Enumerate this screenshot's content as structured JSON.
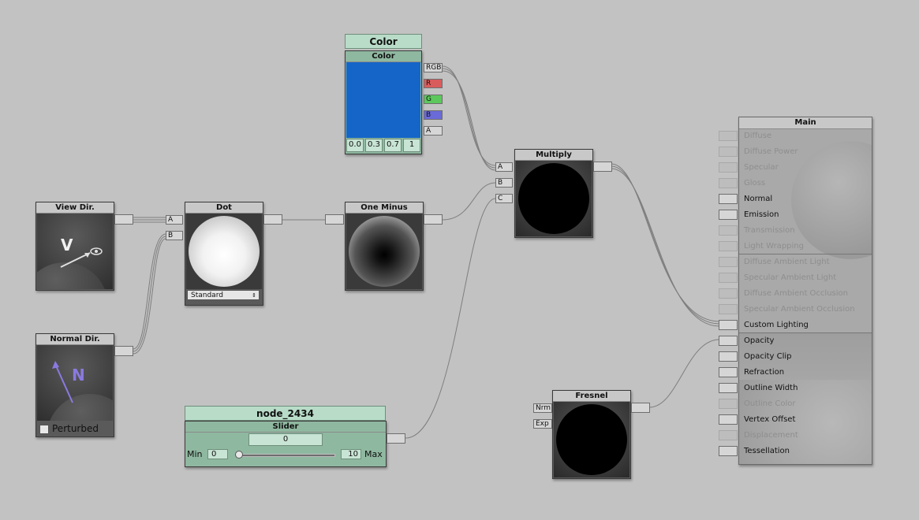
{
  "nodes": {
    "color": {
      "header": "Color",
      "title": "Color",
      "swatch": "#1565c8",
      "ports": [
        "RGB",
        "R",
        "G",
        "B",
        "A"
      ],
      "values": [
        "0.0",
        "0.3",
        "0.7",
        "1"
      ]
    },
    "view_dir": {
      "title": "View Dir.",
      "glyph": "V"
    },
    "normal_dir": {
      "title": "Normal Dir.",
      "glyph": "N",
      "checkbox_label": "Perturbed",
      "checkbox_checked": false
    },
    "dot": {
      "title": "Dot",
      "inputs": [
        "A",
        "B"
      ],
      "mode": "Standard"
    },
    "one_minus": {
      "title": "One Minus"
    },
    "multiply": {
      "title": "Multiply",
      "inputs": [
        "A",
        "B",
        "C"
      ]
    },
    "fresnel": {
      "title": "Fresnel",
      "inputs": [
        "Nrm",
        "Exp"
      ]
    },
    "slider": {
      "header": "node_2434",
      "title": "Slider",
      "value": "0",
      "min_label": "Min",
      "min_value": "0",
      "max_value": "10",
      "max_label": "Max",
      "level": 0.0
    }
  },
  "main": {
    "title": "Main",
    "rows": [
      {
        "label": "Diffuse",
        "active": false
      },
      {
        "label": "Diffuse Power",
        "active": false
      },
      {
        "label": "Specular",
        "active": false
      },
      {
        "label": "Gloss",
        "active": false
      },
      {
        "label": "Normal",
        "active": true
      },
      {
        "label": "Emission",
        "active": true
      },
      {
        "label": "Transmission",
        "active": false
      },
      {
        "label": "Light Wrapping",
        "active": false
      },
      {
        "label": "Diffuse Ambient Light",
        "active": false
      },
      {
        "label": "Specular Ambient Light",
        "active": false
      },
      {
        "label": "Diffuse Ambient Occlusion",
        "active": false
      },
      {
        "label": "Specular Ambient Occlusion",
        "active": false
      },
      {
        "label": "Custom Lighting",
        "active": true
      },
      {
        "label": "Opacity",
        "active": true
      },
      {
        "label": "Opacity Clip",
        "active": true
      },
      {
        "label": "Refraction",
        "active": true
      },
      {
        "label": "Outline Width",
        "active": true
      },
      {
        "label": "Outline Color",
        "active": false
      },
      {
        "label": "Vertex Offset",
        "active": true
      },
      {
        "label": "Displacement",
        "active": false
      },
      {
        "label": "Tessellation",
        "active": true
      }
    ]
  },
  "colors": {
    "canvas": "#c2c2c2",
    "node_body": "#5a5a5a",
    "green_node": "#8fb8a0",
    "port_r": "#d95c5c",
    "port_g": "#5cc85c",
    "port_b": "#6a6ad8"
  }
}
